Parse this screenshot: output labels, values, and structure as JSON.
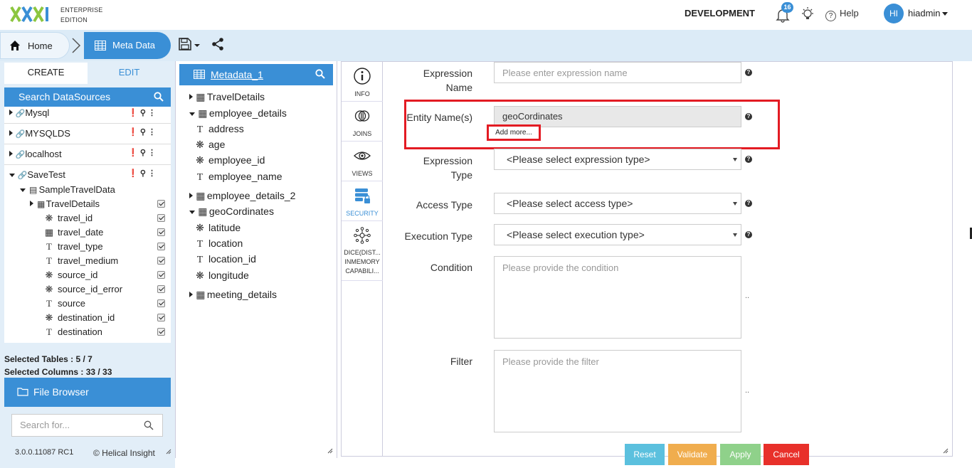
{
  "topbar": {
    "edition_line1": "ENTERPRISE",
    "edition_line2": "EDITION",
    "environment": "DEVELOPMENT",
    "notifications_count": "16",
    "help_label": "Help",
    "avatar_initials": "HI",
    "username": "hiadmin"
  },
  "breadcrumb": {
    "home_label": "Home",
    "current_label": "Meta Data"
  },
  "left": {
    "tab_create": "CREATE",
    "tab_edit": "EDIT",
    "search_datasources": "Search DataSources",
    "datasources": [
      "Mysql",
      "MYSQLDS",
      "localhost",
      "SaveTest"
    ],
    "database": "SampleTravelData",
    "table": "TravelDetails",
    "columns": [
      "travel_id",
      "travel_date",
      "travel_type",
      "travel_medium",
      "source_id",
      "source_id_error",
      "source",
      "destination_id",
      "destination"
    ],
    "selected_tables": "Selected Tables : 5 / 7",
    "selected_columns": "Selected Columns : 33 / 33",
    "file_browser": "File Browser",
    "search_placeholder": "Search for...",
    "version": "3.0.0.11087 RC1",
    "copyright": "© Helical Insight"
  },
  "metadata": {
    "title": "Metadata_1",
    "tree": {
      "t1": "TravelDetails",
      "t2": "employee_details",
      "t2c1": "address",
      "t2c2": "age",
      "t2c3": "employee_id",
      "t2c4": "employee_name",
      "t3": "employee_details_2",
      "t4": "geoCordinates",
      "t4c1": "latitude",
      "t4c2": "location",
      "t4c3": "location_id",
      "t4c4": "longitude",
      "t5": "meeting_details"
    }
  },
  "sidebar": {
    "info": "INFO",
    "joins": "JOINS",
    "views": "VIEWS",
    "security": "SECURITY",
    "dice_line1": "DICE(DIST...",
    "dice_line2": "INMEMORY",
    "dice_line3": "CAPABILI..."
  },
  "form": {
    "expression_name_label_1": "Expression",
    "expression_name_label_2": "Name",
    "expression_name_placeholder": "Please enter expression name",
    "entity_names_label": "Entity Name(s)",
    "entity_names_value": "geoCordinates",
    "add_more": "Add more...",
    "expression_type_label_1": "Expression",
    "expression_type_label_2": "Type",
    "expression_type_value": "<Please select expression type>",
    "access_type_label": "Access Type",
    "access_type_value": "<Please select access type>",
    "execution_type_label": "Execution Type",
    "execution_type_value": "<Please select execution type>",
    "condition_label": "Condition",
    "condition_placeholder": "Please provide the condition",
    "filter_label": "Filter",
    "filter_placeholder": "Please provide the filter",
    "reset": "Reset",
    "validate": "Validate",
    "apply": "Apply",
    "cancel": "Cancel"
  },
  "colors": {
    "accent": "#3a8fd6",
    "highlight": "#e31b23",
    "reset": "#5bc0de",
    "validate": "#f0ad4e",
    "apply": "#8fd18a",
    "cancel": "#e8302a"
  }
}
